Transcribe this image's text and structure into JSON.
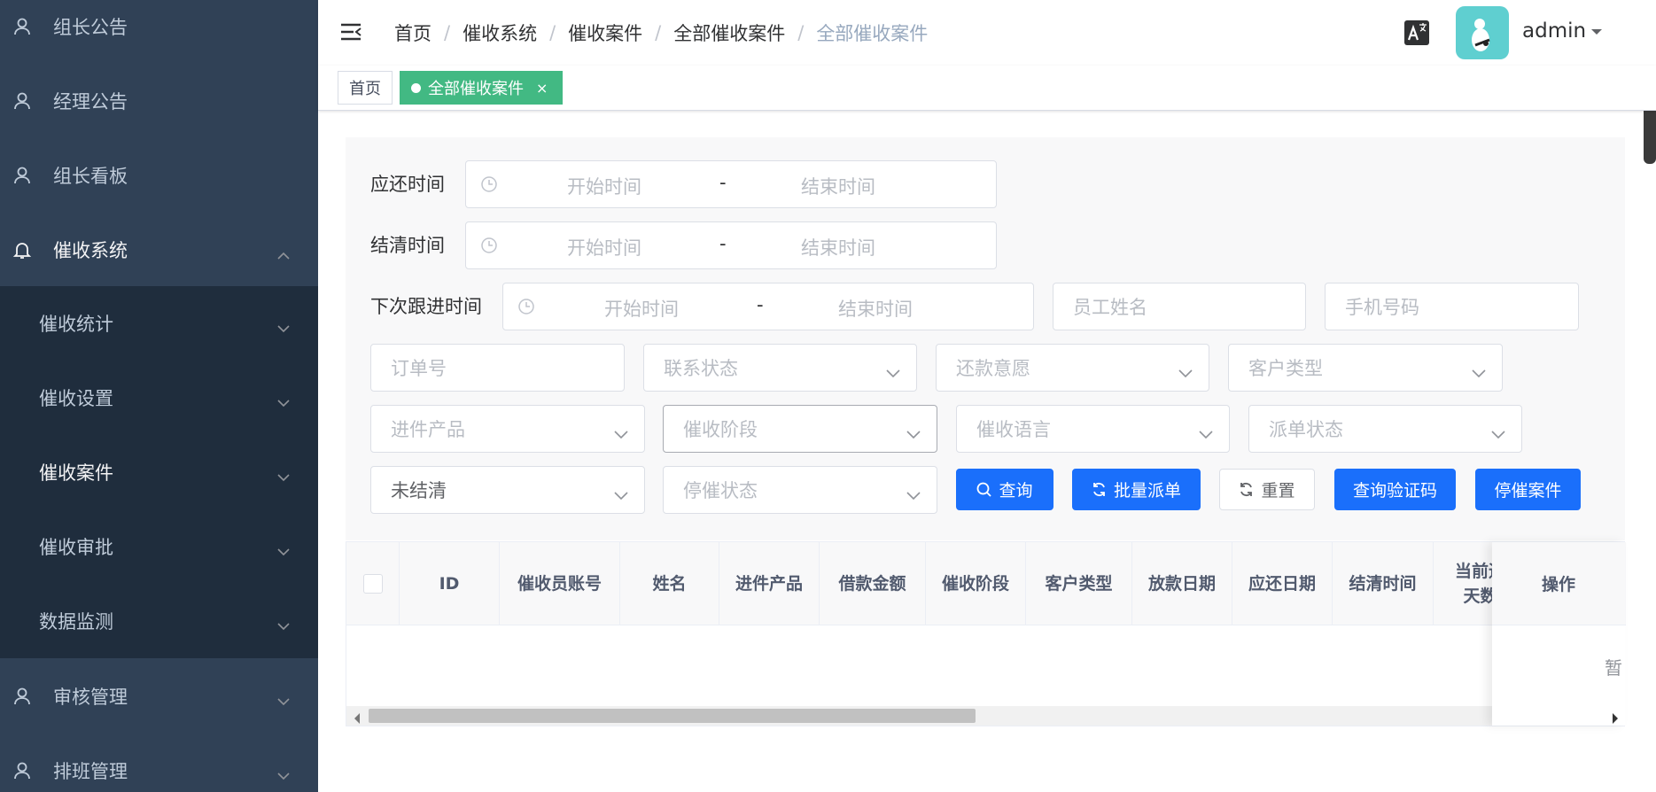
{
  "sidebar": {
    "items": [
      {
        "label": "组长公告",
        "icon": "user-icon"
      },
      {
        "label": "经理公告",
        "icon": "user-icon"
      },
      {
        "label": "组长看板",
        "icon": "user-icon"
      },
      {
        "label": "催收系统",
        "icon": "bell-icon"
      },
      {
        "label": "催收统计"
      },
      {
        "label": "催收设置"
      },
      {
        "label": "催收案件"
      },
      {
        "label": "催收审批"
      },
      {
        "label": "数据监测"
      },
      {
        "label": "审核管理",
        "icon": "user-icon"
      },
      {
        "label": "排班管理",
        "icon": "user-icon"
      }
    ]
  },
  "header": {
    "breadcrumb": [
      "首页",
      "催收系统",
      "催收案件",
      "全部催收案件",
      "全部催收案件"
    ],
    "breadcrumb_sep": "/",
    "username": "admin"
  },
  "tags": {
    "home": "首页",
    "active": "全部催收案件",
    "close": "×"
  },
  "filters": {
    "due_time_label": "应还时间",
    "settle_time_label": "结清时间",
    "next_follow_label": "下次跟进时间",
    "range_start": "开始时间",
    "range_sep": "-",
    "range_end": "结束时间",
    "employee_name": "员工姓名",
    "phone": "手机号码",
    "order_no": "订单号",
    "contact_status": "联系状态",
    "repay_intent": "还款意愿",
    "customer_type": "客户类型",
    "product": "进件产品",
    "stage": "催收阶段",
    "language": "催收语言",
    "dispatch_status": "派单状态",
    "settle_status_value": "未结清",
    "stop_status": "停催状态"
  },
  "buttons": {
    "query": "查询",
    "batch_dispatch": "批量派单",
    "reset": "重置",
    "query_code": "查询验证码",
    "stop_case": "停催案件"
  },
  "table": {
    "columns": [
      "ID",
      "催收员账号",
      "姓名",
      "进件产品",
      "借款金额",
      "催收阶段",
      "客户类型",
      "放款日期",
      "应还日期",
      "结清时间",
      "当前逾\n天数",
      "操作"
    ],
    "empty_text": "暂"
  },
  "colors": {
    "sidebar_bg": "#304156",
    "submenu_bg": "#1f2d3d",
    "active_tag": "#42b983",
    "primary": "#1a6ffb",
    "avatar_bg": "#5fcfd0"
  }
}
